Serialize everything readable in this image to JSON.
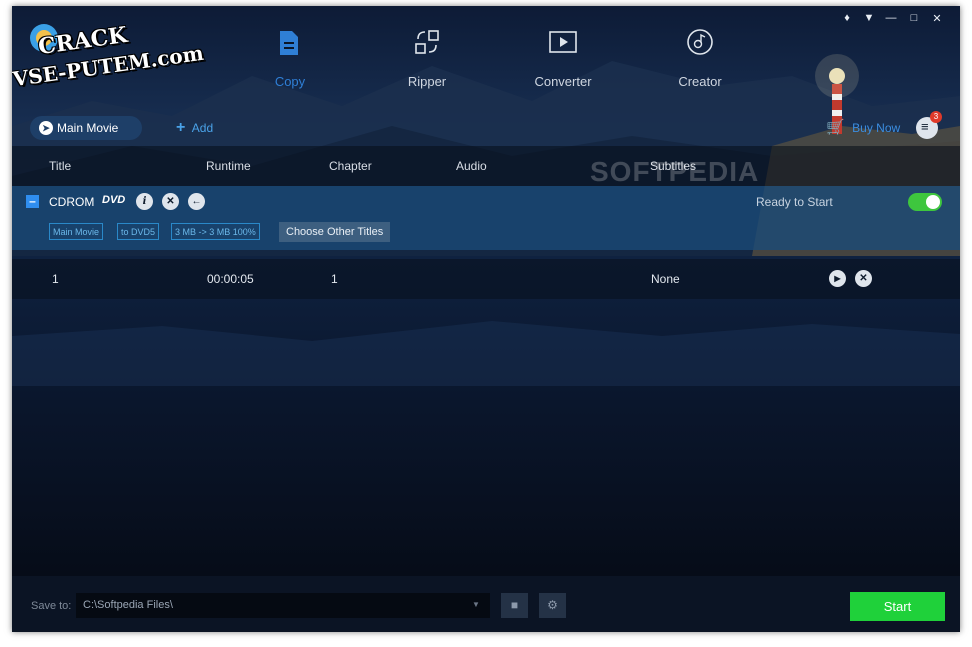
{
  "watermark": {
    "line1": "CRACK",
    "line2": "VSE-PUTEM.com"
  },
  "nav": [
    {
      "label": "Copy",
      "icon": "copy-icon",
      "active": true
    },
    {
      "label": "Ripper",
      "icon": "ripper-icon",
      "active": false
    },
    {
      "label": "Converter",
      "icon": "converter-icon",
      "active": false
    },
    {
      "label": "Creator",
      "icon": "creator-icon",
      "active": false
    }
  ],
  "toolbar": {
    "mode_label": "Main Movie",
    "add_label": "Add",
    "buy_label": "Buy Now",
    "task_badge": "3"
  },
  "columns": {
    "title": "Title",
    "runtime": "Runtime",
    "chapter": "Chapter",
    "audio": "Audio",
    "subtitles": "Subtitles"
  },
  "softpedia_mark": "SOFTPEDIA",
  "source": {
    "name": "CDROM",
    "status": "Ready to Start",
    "tags": [
      "Main Movie",
      "to DVD5",
      "3 MB -> 3 MB 100%"
    ],
    "choose_label": "Choose Other Titles",
    "toggle_on": true
  },
  "titles": [
    {
      "title": "1",
      "runtime": "00:00:05",
      "chapter": "1",
      "audio": "",
      "subtitles": "None"
    }
  ],
  "footer": {
    "save_to_label": "Save to:",
    "save_path": "C:\\Softpedia Files\\",
    "start_label": "Start"
  },
  "colors": {
    "accent": "#2f7fd6",
    "start": "#1fd13a",
    "toggle": "#3ec63e",
    "badge": "#e03a2a"
  }
}
